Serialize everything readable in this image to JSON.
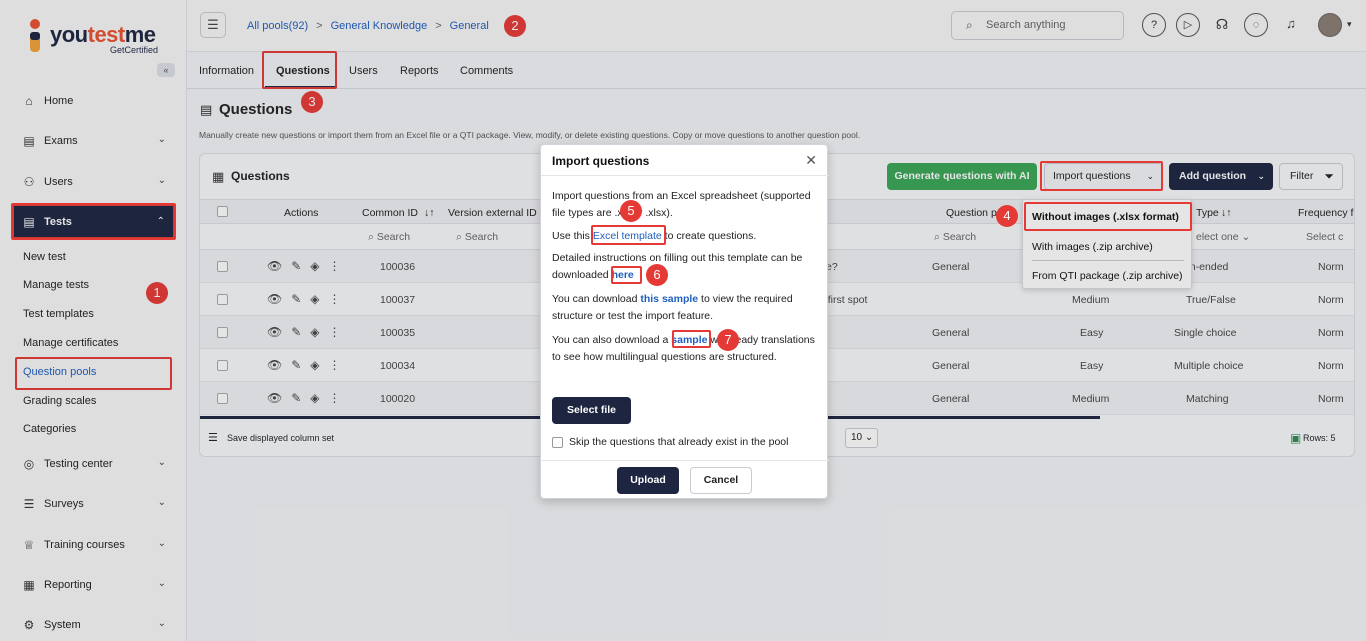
{
  "brand": {
    "name_a": "you",
    "name_b": "test",
    "name_c": "me",
    "tagline": "GetCertified"
  },
  "sidebar": {
    "collapse": "«",
    "items": [
      {
        "label": "Home",
        "icon": "home-icon"
      },
      {
        "label": "Exams",
        "icon": "document-icon"
      },
      {
        "label": "Users",
        "icon": "users-icon"
      },
      {
        "label": "Tests",
        "icon": "tests-icon"
      },
      {
        "label": "Testing center",
        "icon": "testing-center-icon"
      },
      {
        "label": "Surveys",
        "icon": "list-icon"
      },
      {
        "label": "Training courses",
        "icon": "trophy-icon"
      },
      {
        "label": "Reporting",
        "icon": "chart-icon"
      },
      {
        "label": "System",
        "icon": "gear-icon"
      }
    ],
    "tests_sub": [
      "New test",
      "Manage tests",
      "Test templates",
      "Manage certificates",
      "Question pools",
      "Grading scales",
      "Categories"
    ]
  },
  "topbar": {
    "breadcrumbs": [
      "All pools(92)",
      "General Knowledge",
      "General"
    ],
    "search_placeholder": "Search anything"
  },
  "tabs": [
    "Information",
    "Questions",
    "Users",
    "Reports",
    "Comments"
  ],
  "page": {
    "title": "Questions",
    "description": "Manually create new questions or import them from an Excel file or a QTI package. View, modify, or delete existing questions. Copy or move questions to another question pool."
  },
  "card": {
    "title": "Questions",
    "btn_ai": "Generate questions with AI",
    "btn_import": "Import questions",
    "btn_add": "Add question",
    "btn_filter": "Filter",
    "columns": [
      "Actions",
      "Common ID",
      "Version external ID",
      "Question p",
      "Type",
      "Frequency f"
    ],
    "filters": {
      "search": "Search",
      "select_one": "elect one",
      "select_c": "Select c"
    },
    "rows": [
      {
        "id": "100036",
        "text": "e?",
        "pool": "General",
        "difficulty": "",
        "type": "en-ended",
        "freq": "Norm"
      },
      {
        "id": "100037",
        "text": "e first spot",
        "pool": "Medium",
        "difficulty": "",
        "type": "True/False",
        "freq": "Norm"
      },
      {
        "id": "100035",
        "text": "",
        "pool": "General",
        "difficulty": "Easy",
        "type": "Single choice",
        "freq": "Norm"
      },
      {
        "id": "100034",
        "text": "",
        "pool": "General",
        "difficulty": "Easy",
        "type": "Multiple choice",
        "freq": "Norm"
      },
      {
        "id": "100020",
        "text": "",
        "pool": "General",
        "difficulty": "Medium",
        "type": "Matching",
        "freq": "Norm"
      }
    ],
    "footer": {
      "save_cols": "Save displayed column set",
      "page_size": "10",
      "rows": "Rows: 5"
    }
  },
  "dropdown": [
    "Without images (.xlsx format)",
    "With images (.zip archive)",
    "From QTI package (.zip archive)"
  ],
  "modal": {
    "title": "Import questions",
    "p1": "Import questions from an Excel spreadsheet (supported file types are .xls or .xlsx).",
    "p2a": "Use this ",
    "p2link": "Excel template",
    "p2b": " to create questions.",
    "p3a": "Detailed instructions on filling out this template can be downloaded ",
    "p3link": "here",
    "p4a": "You can download ",
    "p4link": "this sample",
    "p4b": " to view the required structure or test the import feature.",
    "p5a": "You can also download a ",
    "p5link": "sample",
    "p5b": " with ready translations to see how multilingual questions are structured.",
    "select_file": "Select file",
    "skip": "Skip the questions that already exist in the pool",
    "upload": "Upload",
    "cancel": "Cancel"
  },
  "badges": [
    "1",
    "2",
    "3",
    "4",
    "5",
    "6",
    "7"
  ],
  "colors": {
    "navy": "#1d2540",
    "accent_red": "#e53935",
    "link": "#1f5fbf",
    "ai_green": "#3aa655"
  }
}
